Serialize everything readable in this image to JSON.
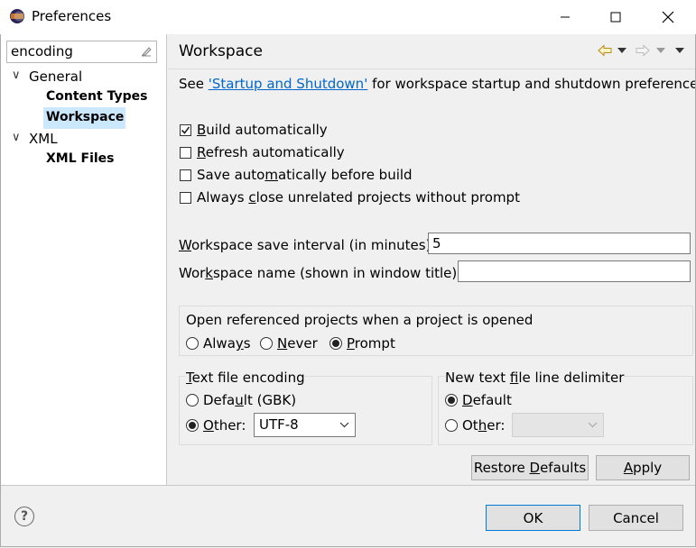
{
  "window": {
    "title": "Preferences"
  },
  "filter": {
    "value": "encoding"
  },
  "tree": {
    "general": "General",
    "content_types": "Content Types",
    "workspace": "Workspace",
    "xml": "XML",
    "xml_files": "XML Files"
  },
  "page": {
    "title": "Workspace",
    "see_prefix": "See ",
    "see_link": "'Startup and Shutdown'",
    "see_suffix": " for workspace startup and shutdown preferences.",
    "checkboxes": [
      {
        "mnemonic": "B",
        "rest": "uild automatically",
        "checked": true
      },
      {
        "mnemonic": "R",
        "rest": "efresh automatically",
        "checked": false
      },
      {
        "pre": "Save auto",
        "mnemonic": "m",
        "rest": "atically before build",
        "checked": false
      },
      {
        "pre": "Always ",
        "mnemonic": "c",
        "rest": "lose unrelated projects without prompt",
        "checked": false
      }
    ],
    "save_interval": {
      "mnemonic": "W",
      "rest": "orkspace save interval (in minutes):",
      "value": "5"
    },
    "ws_name": {
      "pre": "Wor",
      "mnemonic": "k",
      "rest": "space name (shown in window title):",
      "value": ""
    },
    "open_projects": {
      "title": "Open referenced projects when a project is opened",
      "always": {
        "pre": "Alwa",
        "mnemonic": "y",
        "rest": "s"
      },
      "never": {
        "mnemonic": "N",
        "rest": "ever"
      },
      "prompt": {
        "mnemonic": "P",
        "rest": "rompt"
      },
      "selected": "prompt"
    },
    "encoding": {
      "title": {
        "mnemonic": "T",
        "rest": "ext file encoding"
      },
      "default": {
        "pre": "Defa",
        "mnemonic": "u",
        "rest": "lt (GBK)"
      },
      "other": {
        "mnemonic": "O",
        "rest": "ther:"
      },
      "other_value": "UTF-8"
    },
    "delimiter": {
      "title": {
        "pre": "New text ",
        "mnemonic": "f",
        "rest": "ile line delimiter"
      },
      "default": {
        "mnemonic": "D",
        "rest": "efault"
      },
      "other": {
        "pre": "Ot",
        "mnemonic": "h",
        "rest": "er:"
      }
    },
    "restore_defaults": {
      "pre": "Restore ",
      "mnemonic": "D",
      "rest": "efaults"
    },
    "apply": {
      "mnemonic": "A",
      "rest": "pply"
    }
  },
  "footer": {
    "ok": "OK",
    "cancel": "Cancel"
  }
}
